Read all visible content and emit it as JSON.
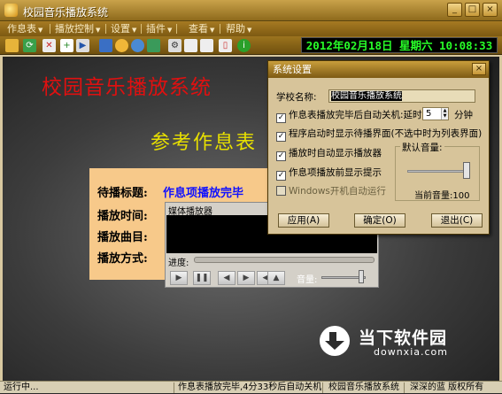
{
  "window": {
    "title": "校园音乐播放系统"
  },
  "titlebar_buttons": [
    "_",
    "□",
    "×"
  ],
  "menu": [
    {
      "label": "作息表"
    },
    {
      "label": "播放控制"
    },
    {
      "label": "设置"
    },
    {
      "label": "插件"
    },
    {
      "label": "查看"
    },
    {
      "label": "帮助"
    }
  ],
  "clock": {
    "text": "2012年02月18日 星期六 10:08:33"
  },
  "main": {
    "system_title": "校园音乐播放系统",
    "schedule_title": "参考作息表"
  },
  "info": {
    "pending_title_label": "待播标题:",
    "pending_title_value": "作息项播放完毕",
    "play_time_label": "播放时间:",
    "play_track_label": "播放曲目:",
    "play_mode_label": "播放方式:"
  },
  "player": {
    "title": "媒体播放器",
    "progress_label": "进度:",
    "volume_label": "音量:",
    "buttons": [
      "▶",
      "❚❚",
      "◀",
      "▶",
      "◀",
      "▲"
    ]
  },
  "settings": {
    "title": "系统设置",
    "school_label": "学校名称:",
    "school_value": "校园音乐播放系统",
    "opt_auto_shutdown": "作息表播放完毕后自动关机:延时",
    "delay_value": "5",
    "delay_unit": "分钟",
    "opt_startup_screen": "程序启动时显示待播界面(不选中时为列表界面)",
    "opt_show_player": "播放时自动显示播放器",
    "opt_show_prompt": "作息项播放前显示提示",
    "opt_windows_autorun": "Windows开机自动运行",
    "default_volume_label": "默认音量:",
    "current_volume": "当前音量:100",
    "checks": {
      "auto_shutdown": true,
      "startup_screen": true,
      "show_player": true,
      "show_prompt": true,
      "windows_autorun": false
    },
    "apply": "应用(A)",
    "ok": "确定(O)",
    "exit": "退出(C)"
  },
  "logo": {
    "cn": "当下软件园",
    "en": "downxia.com"
  },
  "status": {
    "left": "运行中...",
    "message": "作息表播放完毕,4分33秒后自动关机",
    "app": "校园音乐播放系统",
    "copyright": "深深的蓝 版权所有"
  },
  "colors": {
    "clock_text": "#28ff28",
    "system_title": "#e01010",
    "schedule_title": "#e8e000",
    "panel_bg": "#f7c98a",
    "highlight_value": "#1010ff"
  }
}
